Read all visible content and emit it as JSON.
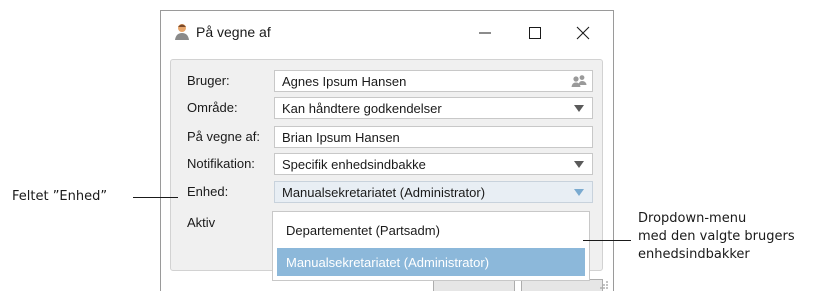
{
  "window": {
    "title": "På vegne af",
    "controls": {
      "minimize": "—",
      "maximize": "☐",
      "close": "✕"
    }
  },
  "form": {
    "bruger": {
      "label": "Bruger:",
      "value": "Agnes Ipsum Hansen",
      "icon": "users-icon"
    },
    "omraade": {
      "label": "Område:",
      "value": "Kan håndtere godkendelser"
    },
    "paa_vegne_af": {
      "label": "På vegne af:",
      "value": "Brian Ipsum Hansen"
    },
    "notifikation": {
      "label": "Notifikation:",
      "value": "Specifik enhedsindbakke"
    },
    "enhed": {
      "label": "Enhed:",
      "value": "Manualsekretariatet (Administrator)"
    },
    "aktiv": {
      "label": "Aktiv"
    }
  },
  "dropdown": {
    "items": [
      {
        "label": "Departementet (Partsadm)",
        "selected": false
      },
      {
        "label": "Manualsekretariatet (Administrator)",
        "selected": true
      }
    ],
    "selected_color": "#8cb8da"
  },
  "annotations": {
    "left": "Feltet ”Enhed”",
    "right_lines": [
      "Dropdown-menu",
      "med den valgte brugers",
      "enhedsindbakker"
    ]
  }
}
